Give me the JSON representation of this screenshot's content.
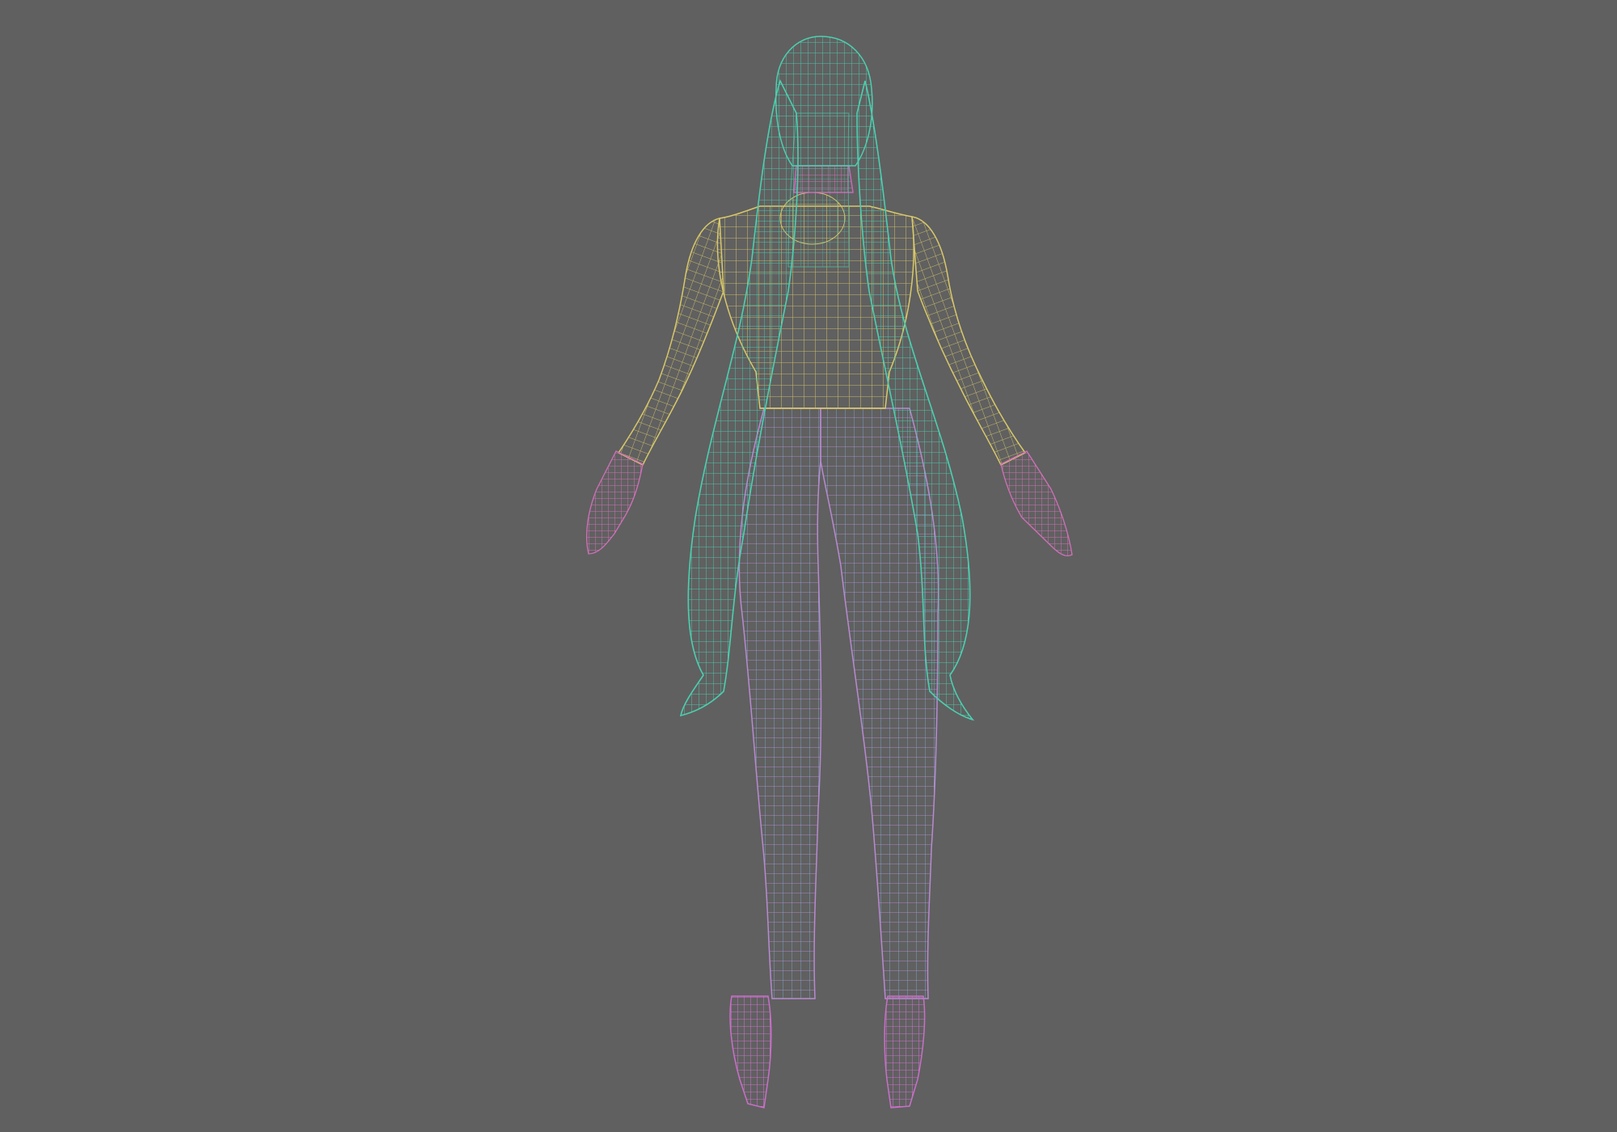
{
  "viewport": {
    "background": "#606060"
  },
  "model": {
    "subject": "character-wireframe-back-view",
    "pose": "A-pose",
    "parts": [
      {
        "name": "hair",
        "color": "#4ccfb0"
      },
      {
        "name": "neck",
        "color": "#c56ab8"
      },
      {
        "name": "torso",
        "color": "#d8c86a"
      },
      {
        "name": "arms",
        "color": "#d8c86a"
      },
      {
        "name": "hands",
        "color": "#d070b8"
      },
      {
        "name": "legs",
        "color": "#b78ad0"
      },
      {
        "name": "legs-secondary",
        "color": "#7fb0d8"
      },
      {
        "name": "shoes",
        "color": "#c870c8"
      }
    ]
  }
}
